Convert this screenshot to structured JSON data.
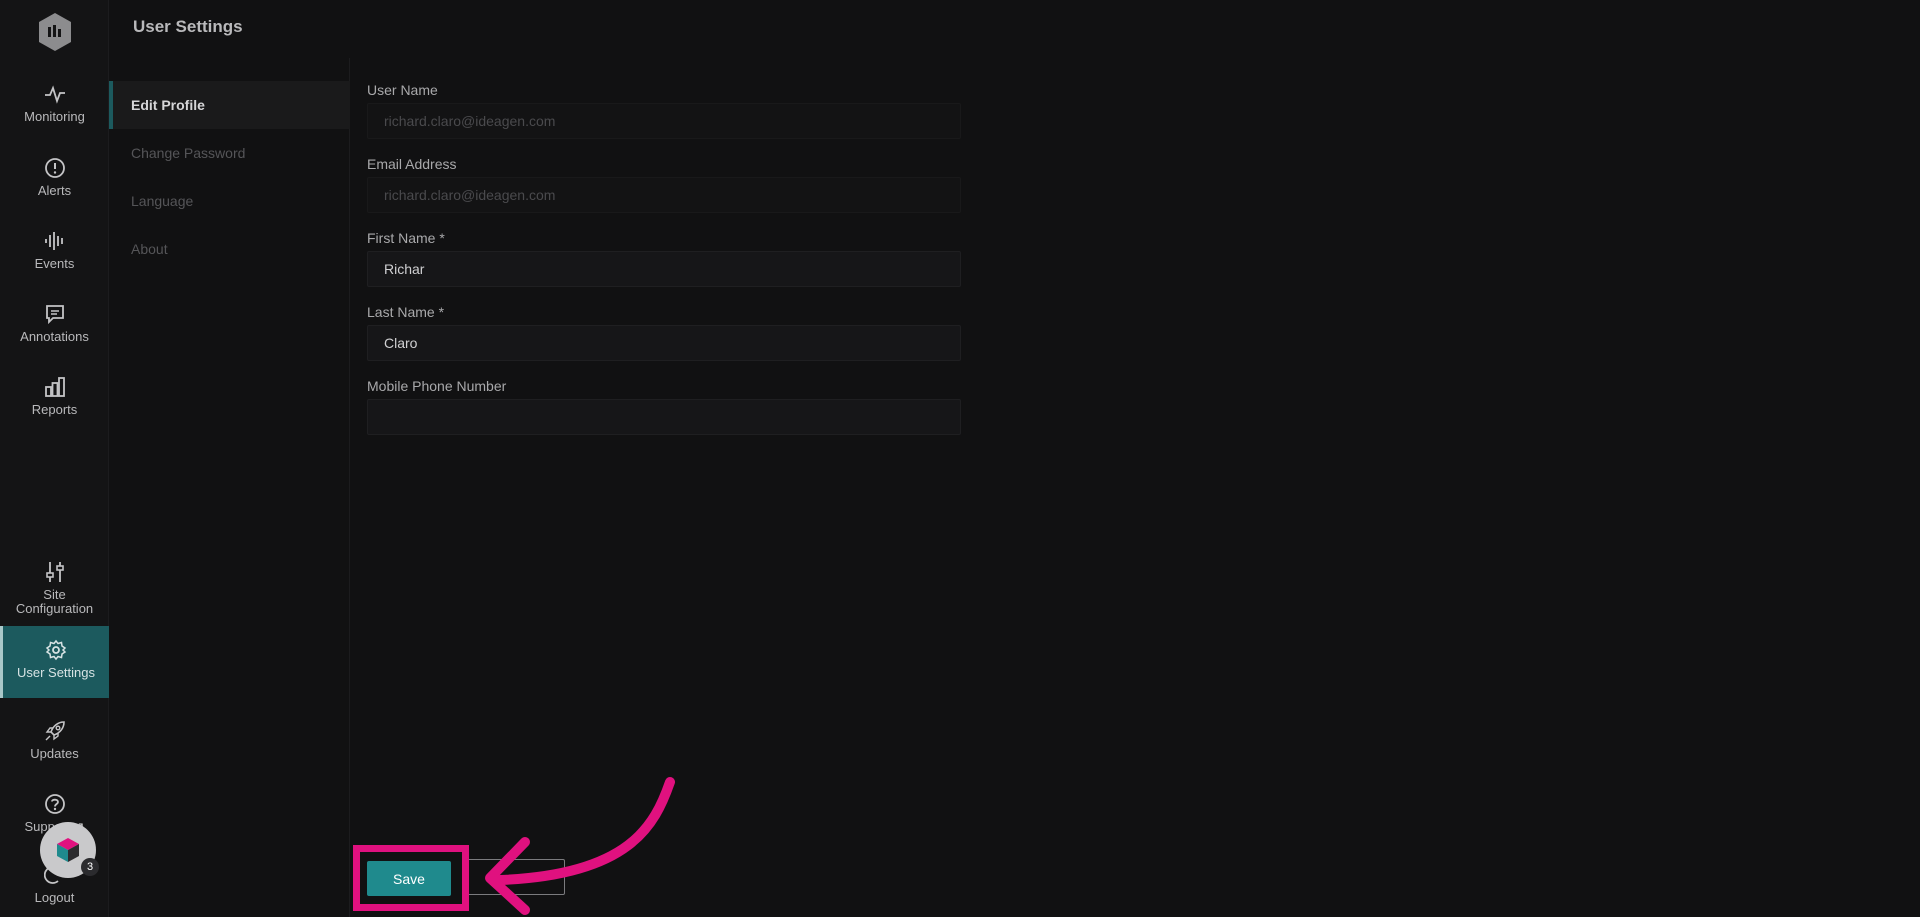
{
  "header": {
    "title": "User Settings"
  },
  "rail": {
    "items": [
      {
        "label": "Monitoring",
        "icon": "pulse-icon"
      },
      {
        "label": "Alerts",
        "icon": "alert-circle-icon"
      },
      {
        "label": "Events",
        "icon": "waveform-icon"
      },
      {
        "label": "Annotations",
        "icon": "comment-icon"
      },
      {
        "label": "Reports",
        "icon": "bar-chart-icon"
      },
      {
        "label": "Site Configuration",
        "icon": "sliders-icon"
      },
      {
        "label": "User Settings",
        "icon": "gear-icon"
      },
      {
        "label": "Updates",
        "icon": "rocket-icon"
      },
      {
        "label": "Support",
        "icon": "help-circle-icon"
      },
      {
        "label": "Logout",
        "icon": "logout-icon"
      }
    ],
    "active_color": "#1c5a5e"
  },
  "subnav": {
    "items": [
      {
        "label": "Edit Profile"
      },
      {
        "label": "Change Password"
      },
      {
        "label": "Language"
      },
      {
        "label": "About"
      }
    ]
  },
  "form": {
    "user_name": {
      "label": "User Name",
      "placeholder": "richard.claro@ideagen.com"
    },
    "email": {
      "label": "Email Address",
      "placeholder": "richard.claro@ideagen.com"
    },
    "first_name": {
      "label": "First Name *",
      "value": "Richar"
    },
    "last_name": {
      "label": "Last Name *",
      "value": "Claro"
    },
    "mobile": {
      "label": "Mobile Phone Number",
      "value": ""
    }
  },
  "actions": {
    "save_label": "Save",
    "accent": "#1f8a8d",
    "highlight": "#e0117f"
  },
  "avatar": {
    "badge_count": "3"
  }
}
